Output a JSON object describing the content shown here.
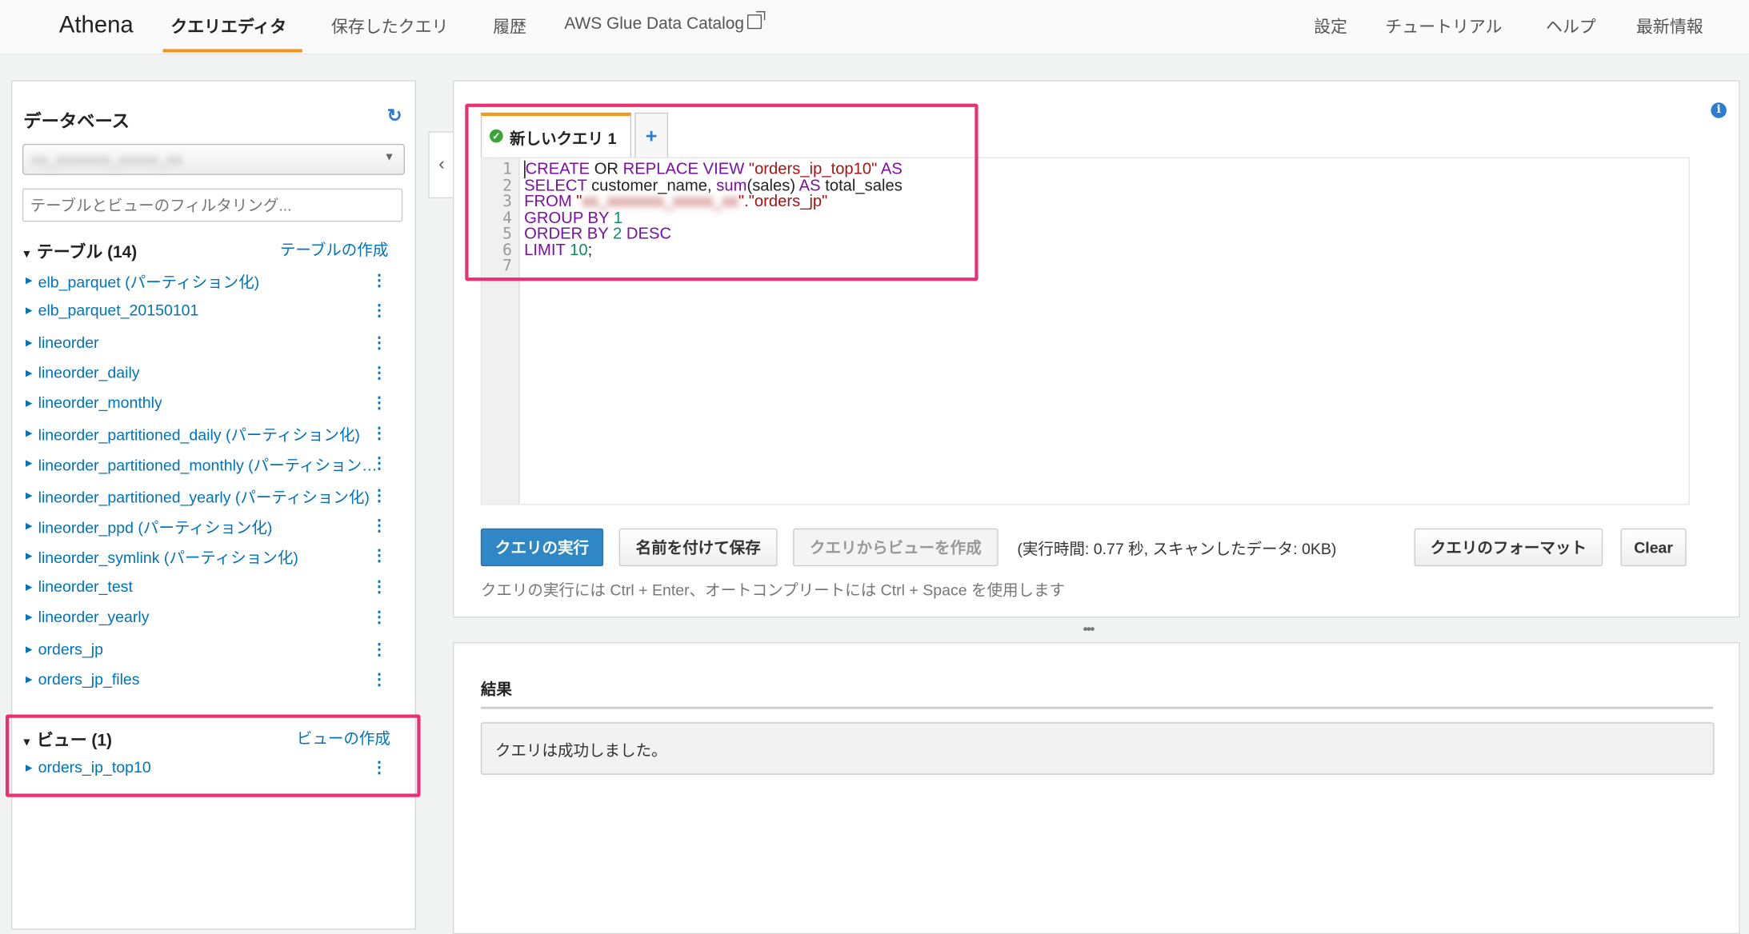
{
  "nav": {
    "brand": "Athena",
    "links": [
      "クエリエディタ",
      "保存したクエリ",
      "履歴",
      "AWS Glue Data Catalog"
    ],
    "right_links": [
      "設定",
      "チュートリアル",
      "ヘルプ",
      "最新情報"
    ]
  },
  "sidebar": {
    "title": "データベース",
    "db_select_value": "xx_xxxxxxx_xxxxx_xx",
    "filter_placeholder": "テーブルとビューのフィルタリング...",
    "tables_header": "テーブル (14)",
    "tables_create": "テーブルの作成",
    "tables": [
      "elb_parquet (パーティション化)",
      "elb_parquet_20150101",
      "lineorder",
      "lineorder_daily",
      "lineorder_monthly",
      "lineorder_partitioned_daily (パーティション化)",
      "lineorder_partitioned_monthly (パーティション化)",
      "lineorder_partitioned_yearly (パーティション化)",
      "lineorder_ppd (パーティション化)",
      "lineorder_symlink (パーティション化)",
      "lineorder_test",
      "lineorder_yearly",
      "orders_jp",
      "orders_jp_files"
    ],
    "views_header": "ビュー (1)",
    "views_create": "ビューの作成",
    "views": [
      "orders_ip_top10"
    ]
  },
  "editor": {
    "tab_label": "新しいクエリ 1",
    "tab_add": "+",
    "line_numbers": [
      "1",
      "2",
      "3",
      "4",
      "5",
      "6",
      "7"
    ],
    "code": {
      "l1_kw1": "CREATE",
      "l1_plain1": " OR ",
      "l1_kw2": "REPLACE VIEW",
      "l1_str": " \"orders_ip_top10\"",
      "l1_kw3": " AS",
      "l2_kw1": "SELECT",
      "l2_plain1": " customer_name, ",
      "l2_kw2": "sum",
      "l2_plain2": "(sales) ",
      "l2_kw3": "AS",
      "l2_plain3": " total_sales",
      "l3_kw": "FROM",
      "l3_str1": " \"",
      "l3_blur": "xx_xxxxxxx_xxxxx_xx",
      "l3_str2": "\".\"orders_jp\"",
      "l4_kw": "GROUP BY",
      "l4_num": " 1",
      "l5_kw": "ORDER BY",
      "l5_num": " 2",
      "l5_kw2": " DESC",
      "l6_kw": "LIMIT",
      "l6_num": " 10",
      "l6_plain": ";"
    },
    "buttons": {
      "run": "クエリの実行",
      "save_as": "名前を付けて保存",
      "create_view": "クエリからビューを作成",
      "format": "クエリのフォーマット",
      "clear": "Clear"
    },
    "exec_info": "(実行時間: 0.77 秒, スキャンしたデータ: 0KB)",
    "hint": "クエリの実行には Ctrl + Enter、オートコンプリートには Ctrl + Space を使用します",
    "splitter": "•••"
  },
  "results": {
    "title": "結果",
    "message": "クエリは成功しました。"
  },
  "colors": {
    "accent": "#f1981c",
    "link": "#0073bb",
    "primary_button": "#2f87c6",
    "highlight": "#ec2e72"
  }
}
